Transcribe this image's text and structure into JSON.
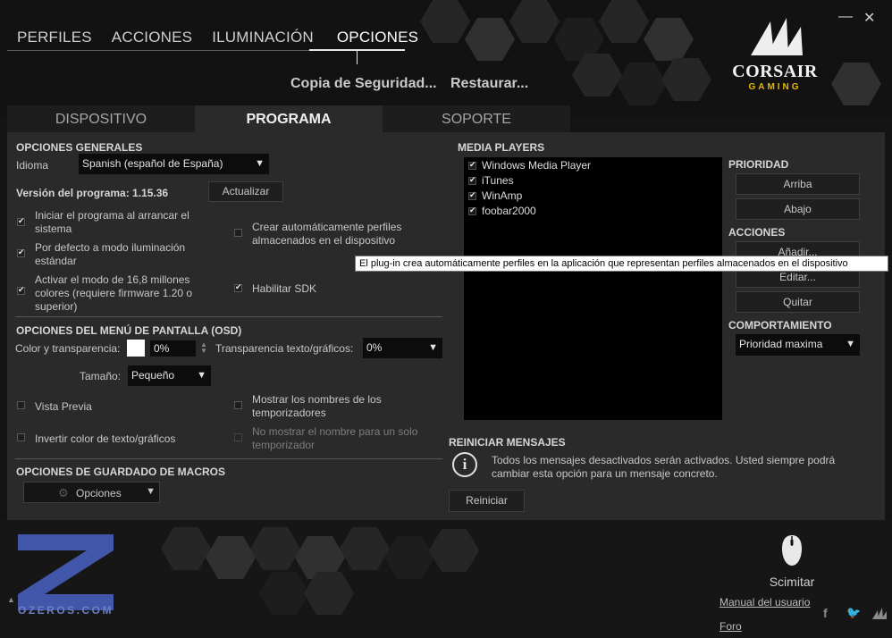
{
  "window": {
    "minimize_label": "—",
    "close_label": "✕"
  },
  "top_nav": {
    "tabs": [
      {
        "label": "PERFILES"
      },
      {
        "label": "ACCIONES"
      },
      {
        "label": "ILUMINACIÓN"
      },
      {
        "label": "OPCIONES"
      }
    ],
    "active": "OPCIONES"
  },
  "actions": {
    "backup": "Copia de Seguridad...",
    "restore": "Restaurar..."
  },
  "logo": {
    "brand": "CORSAIR",
    "tagline": "GAMING"
  },
  "sub_tabs": [
    {
      "label": "DISPOSITIVO"
    },
    {
      "label": "PROGRAMA"
    },
    {
      "label": "SOPORTE"
    }
  ],
  "general": {
    "title": "OPCIONES GENERALES",
    "language_label": "Idioma",
    "language_value": "Spanish (español de España)",
    "version_text": "Versión del programa: 1.15.36",
    "update_button": "Actualizar",
    "options": [
      {
        "label": "Iniciar el programa al arrancar el sistema",
        "checked": true
      },
      {
        "label": "Por defecto a modo iluminación estándar",
        "checked": true
      },
      {
        "label": "Activar el modo de 16,8 millones colores (requiere firmware 1.20 o superior)",
        "checked": true
      },
      {
        "label": "Crear automáticamente perfiles almacenados en el dispositivo",
        "checked": false
      },
      {
        "label": "Habilitar SDK",
        "checked": true
      }
    ]
  },
  "osd": {
    "title": "OPCIONES DEL MENÚ DE PANTALLA (OSD)",
    "color_label": "Color y transparencia:",
    "color_value": "0%",
    "swatch_color": "#ffffff",
    "transparency_label": "Transparencia texto/gráficos:",
    "transparency_value": "0%",
    "size_label": "Tamaño:",
    "size_value": "Pequeño",
    "options": [
      {
        "label": "Vista Previa",
        "checked": false,
        "enabled": true
      },
      {
        "label": "Mostrar los nombres de los temporizadores",
        "checked": false,
        "enabled": true
      },
      {
        "label": "Invertir color de texto/gráficos",
        "checked": false,
        "enabled": true
      },
      {
        "label": "No mostrar el nombre para un solo temporizador",
        "checked": false,
        "enabled": false
      }
    ]
  },
  "macros": {
    "title": "OPCIONES DE GUARDADO DE MACROS",
    "button": "Opciones"
  },
  "media": {
    "title": "MEDIA PLAYERS",
    "players": [
      {
        "label": "Windows Media Player",
        "checked": true
      },
      {
        "label": "iTunes",
        "checked": true
      },
      {
        "label": "WinAmp",
        "checked": true
      },
      {
        "label": "foobar2000",
        "checked": true
      }
    ],
    "priority_title": "PRIORIDAD",
    "up_button": "Arriba",
    "down_button": "Abajo",
    "actions_title": "ACCIONES",
    "add_button": "Añadir...",
    "edit_button": "Editar...",
    "remove_button": "Quitar",
    "behavior_title": "COMPORTAMIENTO",
    "behavior_value": "Prioridad maxima"
  },
  "tooltip": "El plug-in crea automáticamente perfiles en la aplicación que representan perfiles almacenados en el dispositivo",
  "reset": {
    "title": "REINICIAR MENSAJES",
    "text": "Todos los mensajes desactivados serán activados. Usted siempre podrá cambiar esta opción para un mensaje concreto.",
    "button": "Reiniciar"
  },
  "device": {
    "name": "Scimitar"
  },
  "footer": {
    "manual": "Manual del usuario",
    "forum": "Foro",
    "social": [
      "f",
      "t",
      "corsair"
    ]
  },
  "watermark": {
    "text": "OZEROS.COM",
    "color": "#4a62c4"
  },
  "colors": {
    "accent": "#e6b800",
    "panel": "#2a2a2a",
    "background": "#141414"
  }
}
